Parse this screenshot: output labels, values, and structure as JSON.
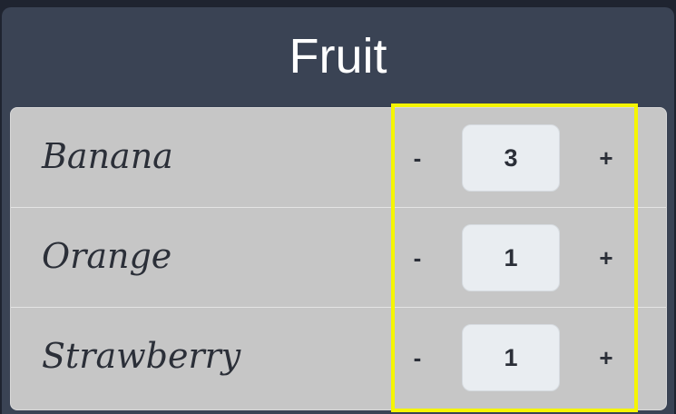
{
  "title": "Fruit",
  "items": [
    {
      "name": "Banana",
      "quantity": "3",
      "decrement_label": "-",
      "increment_label": "+"
    },
    {
      "name": "Orange",
      "quantity": "1",
      "decrement_label": "-",
      "increment_label": "+"
    },
    {
      "name": "Strawberry",
      "quantity": "1",
      "decrement_label": "-",
      "increment_label": "+"
    }
  ],
  "colors": {
    "panel": "#3a4354",
    "list_background": "#c6c6c6",
    "quantity_field": "#e9edf1",
    "highlight": "#f5f500"
  }
}
